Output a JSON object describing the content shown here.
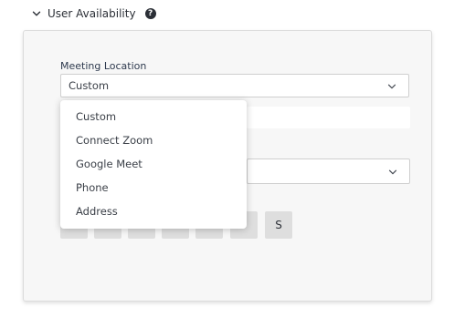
{
  "section": {
    "title": "User Availability",
    "help_icon": "?"
  },
  "meeting_location": {
    "label": "Meeting Location",
    "selected": "Custom"
  },
  "dropdown": {
    "options": [
      "Custom",
      "Connect Zoom",
      "Google Meet",
      "Phone",
      "Address"
    ]
  },
  "days": {
    "labels": [
      "",
      "",
      "",
      "",
      "",
      "",
      "S"
    ]
  }
}
